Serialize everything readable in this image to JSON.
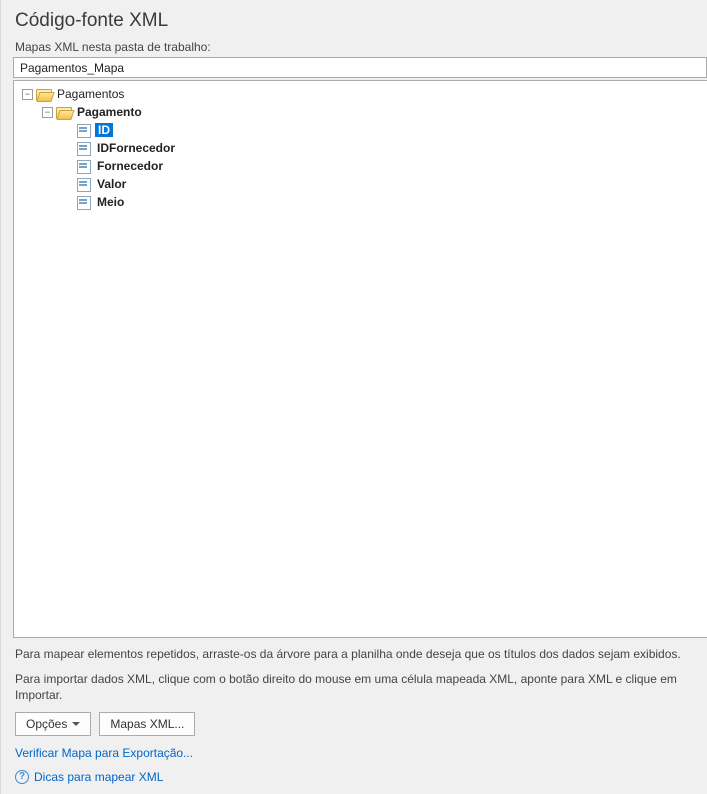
{
  "title": "Código-fonte XML",
  "maps_label": "Mapas XML nesta pasta de trabalho:",
  "map_selected": "Pagamentos_Mapa",
  "tree": {
    "root": {
      "label": "Pagamentos",
      "child": {
        "label": "Pagamento",
        "elements": [
          {
            "label": "ID",
            "selected": true
          },
          {
            "label": "IDFornecedor",
            "selected": false
          },
          {
            "label": "Fornecedor",
            "selected": false
          },
          {
            "label": "Valor",
            "selected": false
          },
          {
            "label": "Meio",
            "selected": false
          }
        ]
      }
    }
  },
  "hint1": "Para mapear elementos repetidos, arraste-os da árvore para a planilha onde deseja que os títulos dos dados sejam exibidos.",
  "hint2": "Para importar dados XML, clique com o botão direito do mouse em uma célula mapeada XML, aponte para XML e clique em Importar.",
  "buttons": {
    "options": "Opções",
    "xml_maps": "Mapas XML..."
  },
  "verify_link": "Verificar Mapa para Exportação...",
  "tips_link": "Dicas para mapear XML",
  "help_glyph": "?"
}
